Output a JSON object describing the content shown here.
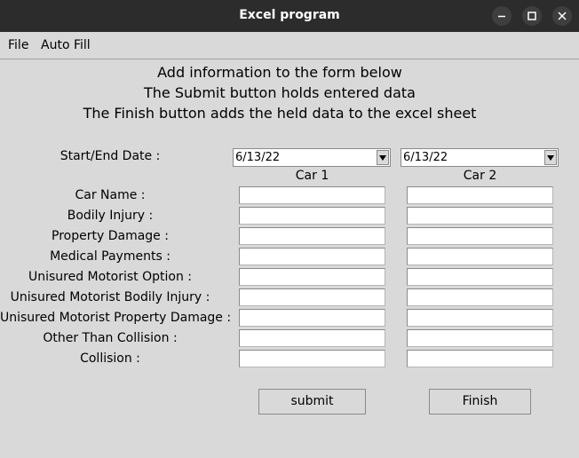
{
  "window": {
    "title": "Excel program"
  },
  "menu": {
    "file": "File",
    "auto_fill": "Auto Fill"
  },
  "header": {
    "line1": "Add information to the form below",
    "line2": "The Submit button holds entered data",
    "line3": "The Finish button adds the held data to the excel sheet"
  },
  "date": {
    "label": "Start/End Date :",
    "start_value": "6/13/22",
    "end_value": "6/13/22"
  },
  "columns": {
    "car1": "Car 1",
    "car2": "Car 2"
  },
  "fields": [
    {
      "label": "Car Name :",
      "car1": "",
      "car2": ""
    },
    {
      "label": "Bodily Injury :",
      "car1": "",
      "car2": ""
    },
    {
      "label": "Property Damage :",
      "car1": "",
      "car2": ""
    },
    {
      "label": "Medical Payments :",
      "car1": "",
      "car2": ""
    },
    {
      "label": "Unisured Motorist Option :",
      "car1": "",
      "car2": ""
    },
    {
      "label": "Unisured Motorist Bodily Injury :",
      "car1": "",
      "car2": ""
    },
    {
      "label": "Unisured Motorist Property Damage :",
      "car1": "",
      "car2": ""
    },
    {
      "label": "Other Than Collision :",
      "car1": "",
      "car2": ""
    },
    {
      "label": "Collision :",
      "car1": "",
      "car2": ""
    }
  ],
  "buttons": {
    "submit": "submit",
    "finish": "Finish"
  },
  "icons": {
    "minimize": "minimize-icon",
    "maximize": "maximize-icon",
    "close": "close-icon",
    "dropdown": "chevron-down-icon"
  },
  "colors": {
    "titlebar": "#2c2c2c",
    "background": "#d9d9d9"
  }
}
